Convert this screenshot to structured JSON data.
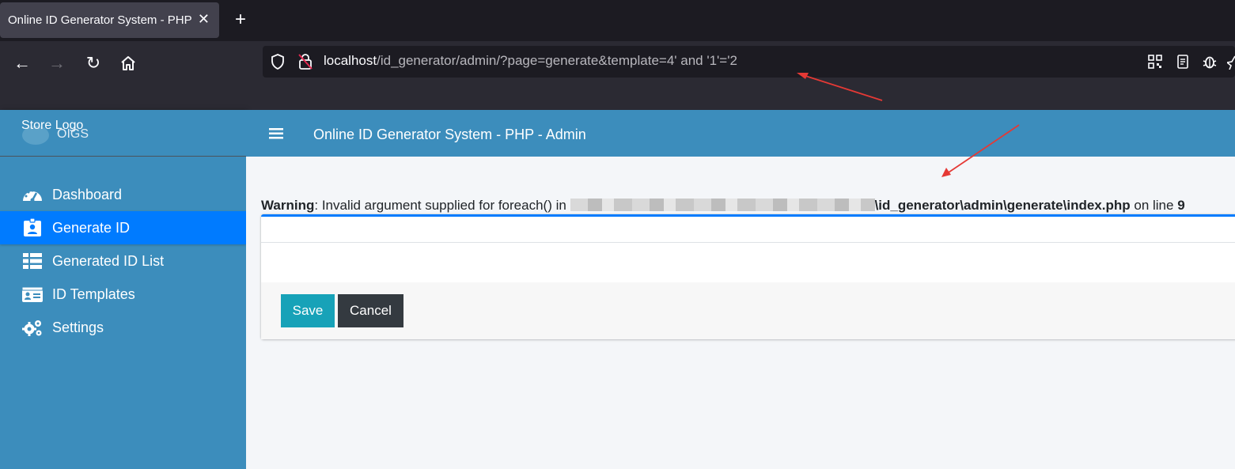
{
  "browser": {
    "tab_title": "Online ID Generator System - PHP",
    "tab_close": "✕",
    "new_tab": "+",
    "url_host": "localhost",
    "url_path": "/id_generator/admin/?page=generate&template=4' and '1'='2",
    "nav": {
      "back": "←",
      "forward": "→",
      "reload": "↻"
    }
  },
  "sidebar": {
    "brand_alt": "Store Logo",
    "brand_name": "OIGS",
    "items": [
      {
        "label": "Dashboard",
        "icon": "dashboard-icon",
        "active": false
      },
      {
        "label": "Generate ID",
        "icon": "id-badge-icon",
        "active": true
      },
      {
        "label": "Generated ID List",
        "icon": "table-list-icon",
        "active": false
      },
      {
        "label": "ID Templates",
        "icon": "id-card-icon",
        "active": false
      },
      {
        "label": "Settings",
        "icon": "gears-icon",
        "active": false
      }
    ]
  },
  "header": {
    "title": "Online ID Generator System - PHP - Admin"
  },
  "warning": {
    "label": "Warning",
    "message": ": Invalid argument supplied for foreach() in",
    "path": "\\id_generator\\admin\\generate\\index.php",
    "line_text": " on line ",
    "line_number": "9"
  },
  "form": {
    "save_label": "Save",
    "cancel_label": "Cancel"
  },
  "colors": {
    "sidebar_bg": "#3c8dbc",
    "active_item": "#007bff",
    "save_button": "#17a2b8",
    "cancel_button": "#343a40",
    "annotation_arrow": "#e53935"
  }
}
